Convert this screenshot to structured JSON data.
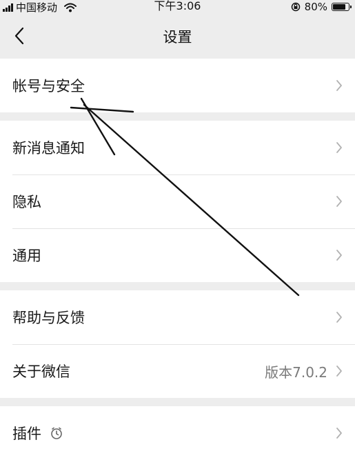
{
  "status_bar": {
    "carrier": "中国移动",
    "time": "下午3:06",
    "battery_percent": "80%",
    "battery_level": 0.8,
    "icons": [
      "signal-bars-icon",
      "wifi-icon",
      "rotation-lock-icon",
      "battery-icon"
    ]
  },
  "nav": {
    "title": "设置",
    "back_icon": "chevron-left-icon"
  },
  "sections": [
    {
      "items": [
        {
          "label": "帐号与安全"
        }
      ]
    },
    {
      "items": [
        {
          "label": "新消息通知"
        },
        {
          "label": "隐私"
        },
        {
          "label": "通用"
        }
      ]
    },
    {
      "items": [
        {
          "label": "帮助与反馈"
        },
        {
          "label": "关于微信",
          "value": "版本7.0.2"
        }
      ]
    },
    {
      "items": [
        {
          "label": "插件",
          "icon": "plugin-timer-icon"
        }
      ]
    }
  ],
  "colors": {
    "background": "#ededed",
    "cell": "#ffffff",
    "divider": "#e3e3e3",
    "value_text": "#7a7a7a",
    "chevron": "#b2b2b2",
    "annotation": "#111111"
  },
  "annotation": {
    "description_icon": "hand-drawn-arrow-icon"
  }
}
